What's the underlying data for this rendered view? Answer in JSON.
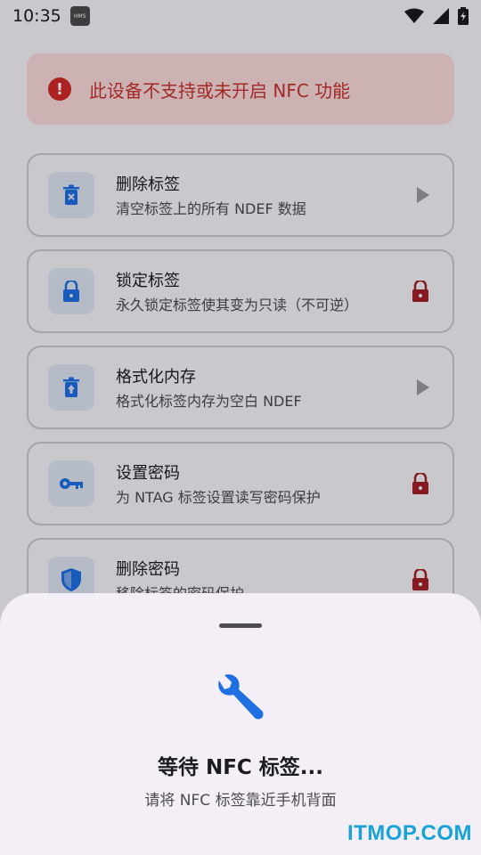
{
  "status_bar": {
    "time": "10:35",
    "badge": "HMS",
    "icons": [
      "wifi-icon",
      "signal-icon",
      "battery-charging-icon"
    ]
  },
  "alert": {
    "text": "此设备不支持或未开启 NFC 功能",
    "color": "#c6322e",
    "icon": "error-icon"
  },
  "actions": [
    {
      "title": "删除标签",
      "subtitle": "清空标签上的所有 NDEF 数据",
      "icon": "delete-icon",
      "trailing": "chevron-right-icon"
    },
    {
      "title": "锁定标签",
      "subtitle": "永久锁定标签使其变为只读（不可逆）",
      "icon": "lock-icon",
      "trailing": "lock-icon"
    },
    {
      "title": "格式化内存",
      "subtitle": "格式化标签内存为空白 NDEF",
      "icon": "format-icon",
      "trailing": "chevron-right-icon"
    },
    {
      "title": "设置密码",
      "subtitle": "为 NTAG 标签设置读写密码保护",
      "icon": "key-icon",
      "trailing": "lock-icon"
    },
    {
      "title": "删除密码",
      "subtitle": "移除标签的密码保护",
      "icon": "shield-icon",
      "trailing": "lock-icon"
    }
  ],
  "sheet": {
    "icon": "wrench-icon",
    "title": "等待 NFC 标签...",
    "subtitle": "请将 NFC 标签靠近手机背面"
  },
  "watermark": "ITMOP.COM",
  "colors": {
    "accent": "#1f6fe3",
    "lock_red": "#a51f28",
    "alert_bg": "#fadadc"
  }
}
